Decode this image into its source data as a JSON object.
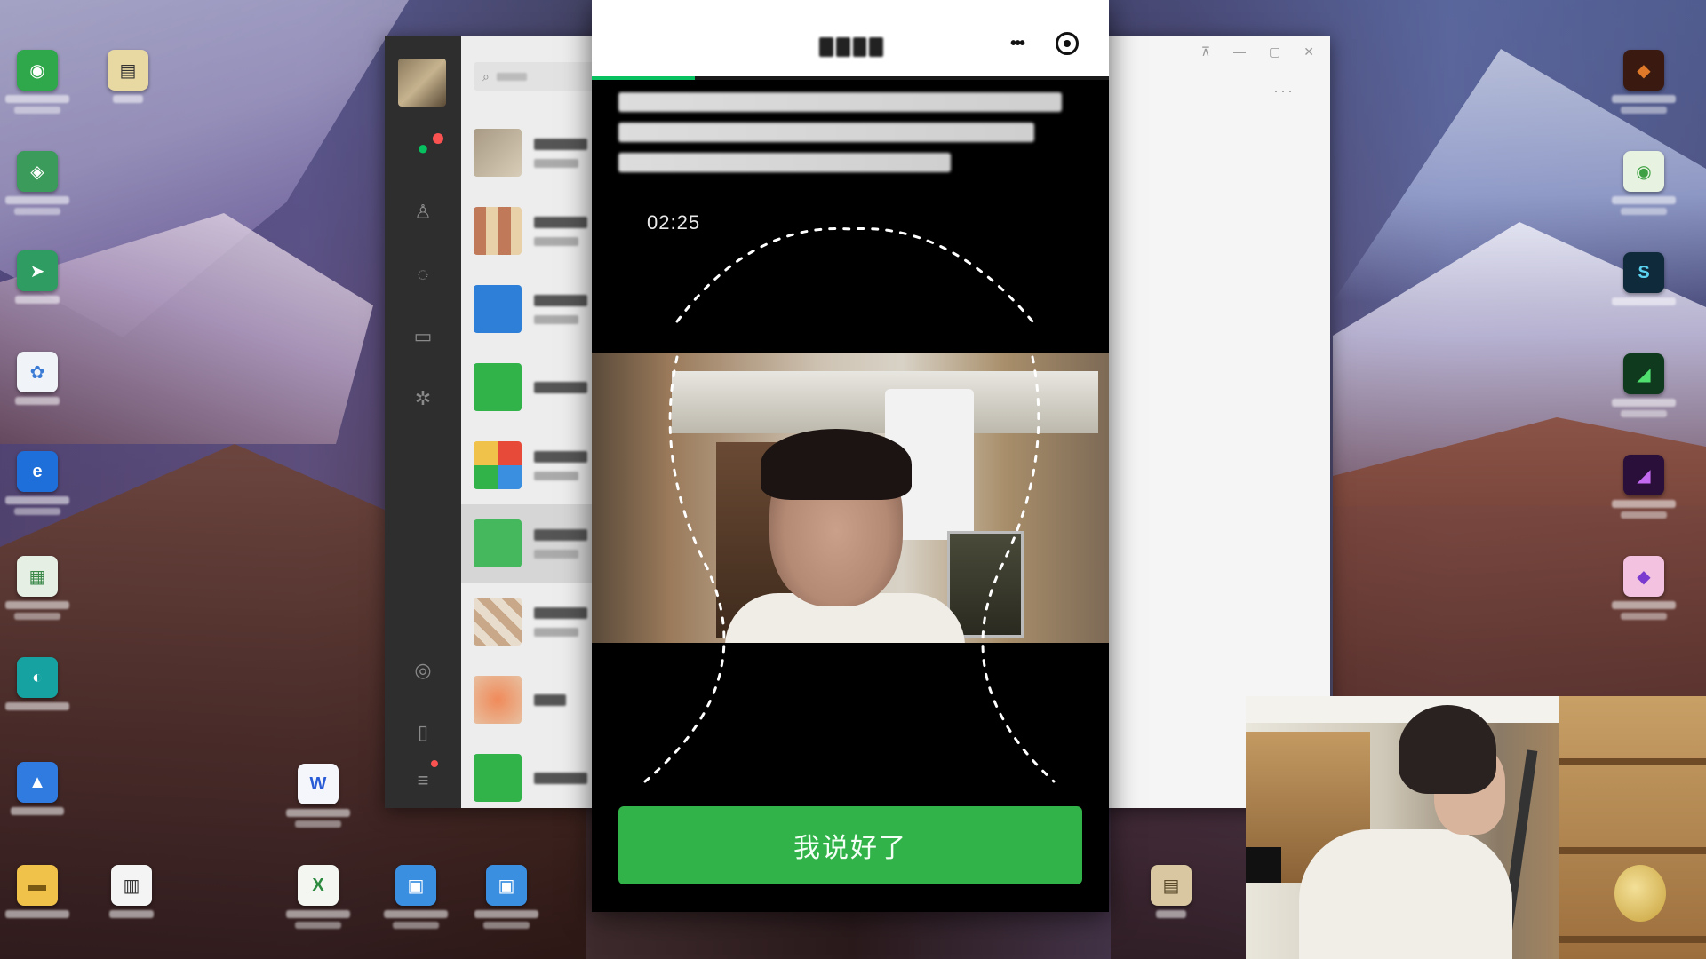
{
  "colors": {
    "wechat_green": "#07c160",
    "button_green": "#31b34a",
    "panel_black": "#000000"
  },
  "wechat": {
    "search_icon": "search-icon",
    "rail_icons": [
      "chat-icon",
      "contacts-icon",
      "favorites-icon",
      "files-icon",
      "settings-icon",
      "moments-icon",
      "phone-icon",
      "menu-icon"
    ]
  },
  "recording": {
    "timer": "02:25",
    "progress": 0.2
  },
  "buttons": {
    "done_label": "我说好了"
  }
}
